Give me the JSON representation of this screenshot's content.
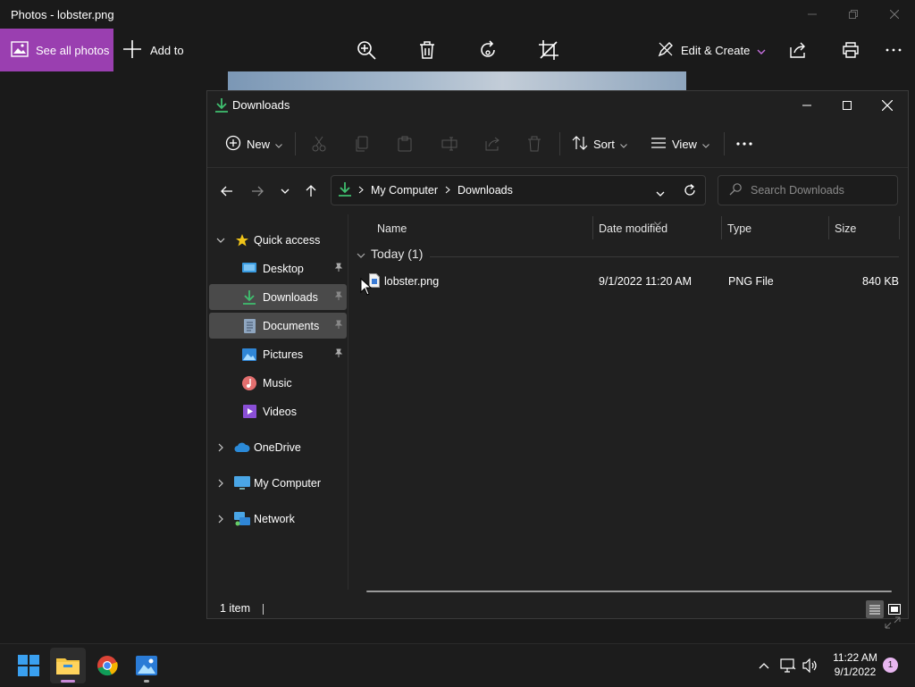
{
  "photos": {
    "title": "Photos - lobster.png",
    "see_all": "See all photos",
    "add_to": "Add to",
    "edit_create": "Edit & Create",
    "accent": "#9a3fb0"
  },
  "explorer": {
    "title": "Downloads",
    "commands": {
      "new": "New",
      "sort": "Sort",
      "view": "View"
    },
    "breadcrumb": [
      "My Computer",
      "Downloads"
    ],
    "search_placeholder": "Search Downloads",
    "sidebar": {
      "quick_access": "Quick access",
      "items": [
        {
          "label": "Desktop",
          "pinned": true
        },
        {
          "label": "Downloads",
          "pinned": true,
          "selected": true
        },
        {
          "label": "Documents",
          "pinned": true,
          "selected": true
        },
        {
          "label": "Pictures",
          "pinned": true
        },
        {
          "label": "Music",
          "pinned": false
        },
        {
          "label": "Videos",
          "pinned": false
        }
      ],
      "roots": [
        "OneDrive",
        "My Computer",
        "Network"
      ]
    },
    "columns": [
      "Name",
      "Date modified",
      "Type",
      "Size"
    ],
    "group": "Today (1)",
    "files": [
      {
        "name": "lobster.png",
        "date": "9/1/2022 11:20 AM",
        "type": "PNG File",
        "size": "840 KB"
      }
    ],
    "status": "1 item"
  },
  "taskbar": {
    "time": "11:22 AM",
    "date": "9/1/2022",
    "notifications": "1"
  }
}
